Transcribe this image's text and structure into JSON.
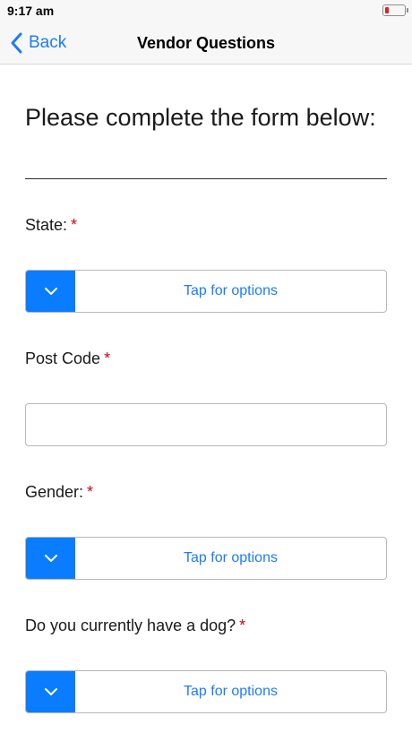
{
  "status": {
    "time": "9:17 am"
  },
  "nav": {
    "back_label": "Back",
    "title": "Vendor Questions"
  },
  "form": {
    "heading": "Please complete the form below:",
    "required_marker": "*",
    "fields": [
      {
        "label": "State:",
        "type": "select",
        "value": "Tap for options"
      },
      {
        "label": "Post Code",
        "type": "text",
        "value": "",
        "placeholder": ""
      },
      {
        "label": "Gender:",
        "type": "select",
        "value": "Tap for options"
      },
      {
        "label": "Do you currently have a dog?",
        "type": "select",
        "value": "Tap for options"
      }
    ]
  },
  "colors": {
    "accent": "#0a7cff",
    "link": "#1e7cf2",
    "required": "#d0021b",
    "battery_low": "#e02020"
  },
  "icons": [
    "back-chevron-icon",
    "chevron-down-icon",
    "battery-icon"
  ]
}
